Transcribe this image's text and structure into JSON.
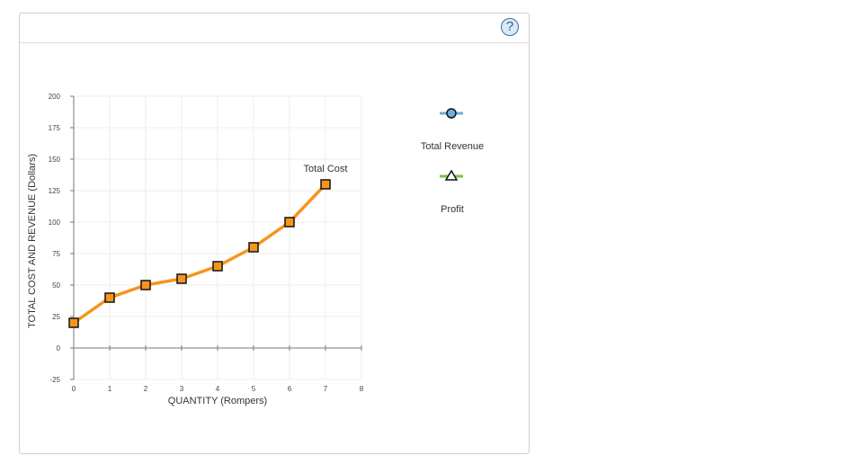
{
  "help": {
    "label": "?"
  },
  "chart_data": {
    "type": "line",
    "xlabel": "QUANTITY (Rompers)",
    "ylabel": "TOTAL COST AND REVENUE (Dollars)",
    "xlim": [
      0,
      8
    ],
    "ylim": [
      -25,
      200
    ],
    "x_ticks": [
      0,
      1,
      2,
      3,
      4,
      5,
      6,
      7,
      8
    ],
    "y_ticks": [
      -25,
      0,
      25,
      50,
      75,
      100,
      125,
      150,
      175,
      200
    ],
    "grid": true,
    "series": [
      {
        "name": "Total Cost",
        "color": "#f7941d",
        "marker": "square",
        "x": [
          0,
          1,
          2,
          3,
          4,
          5,
          6,
          7
        ],
        "y": [
          20,
          40,
          50,
          55,
          65,
          80,
          100,
          130
        ]
      }
    ],
    "legend": {
      "placement": "right",
      "items": [
        {
          "name": "Total Revenue",
          "color": "#6baed6",
          "marker": "circle",
          "icon": "circle-line-icon"
        },
        {
          "name": "Profit",
          "color": "#7cc242",
          "marker": "triangle",
          "icon": "triangle-line-icon"
        }
      ]
    }
  }
}
